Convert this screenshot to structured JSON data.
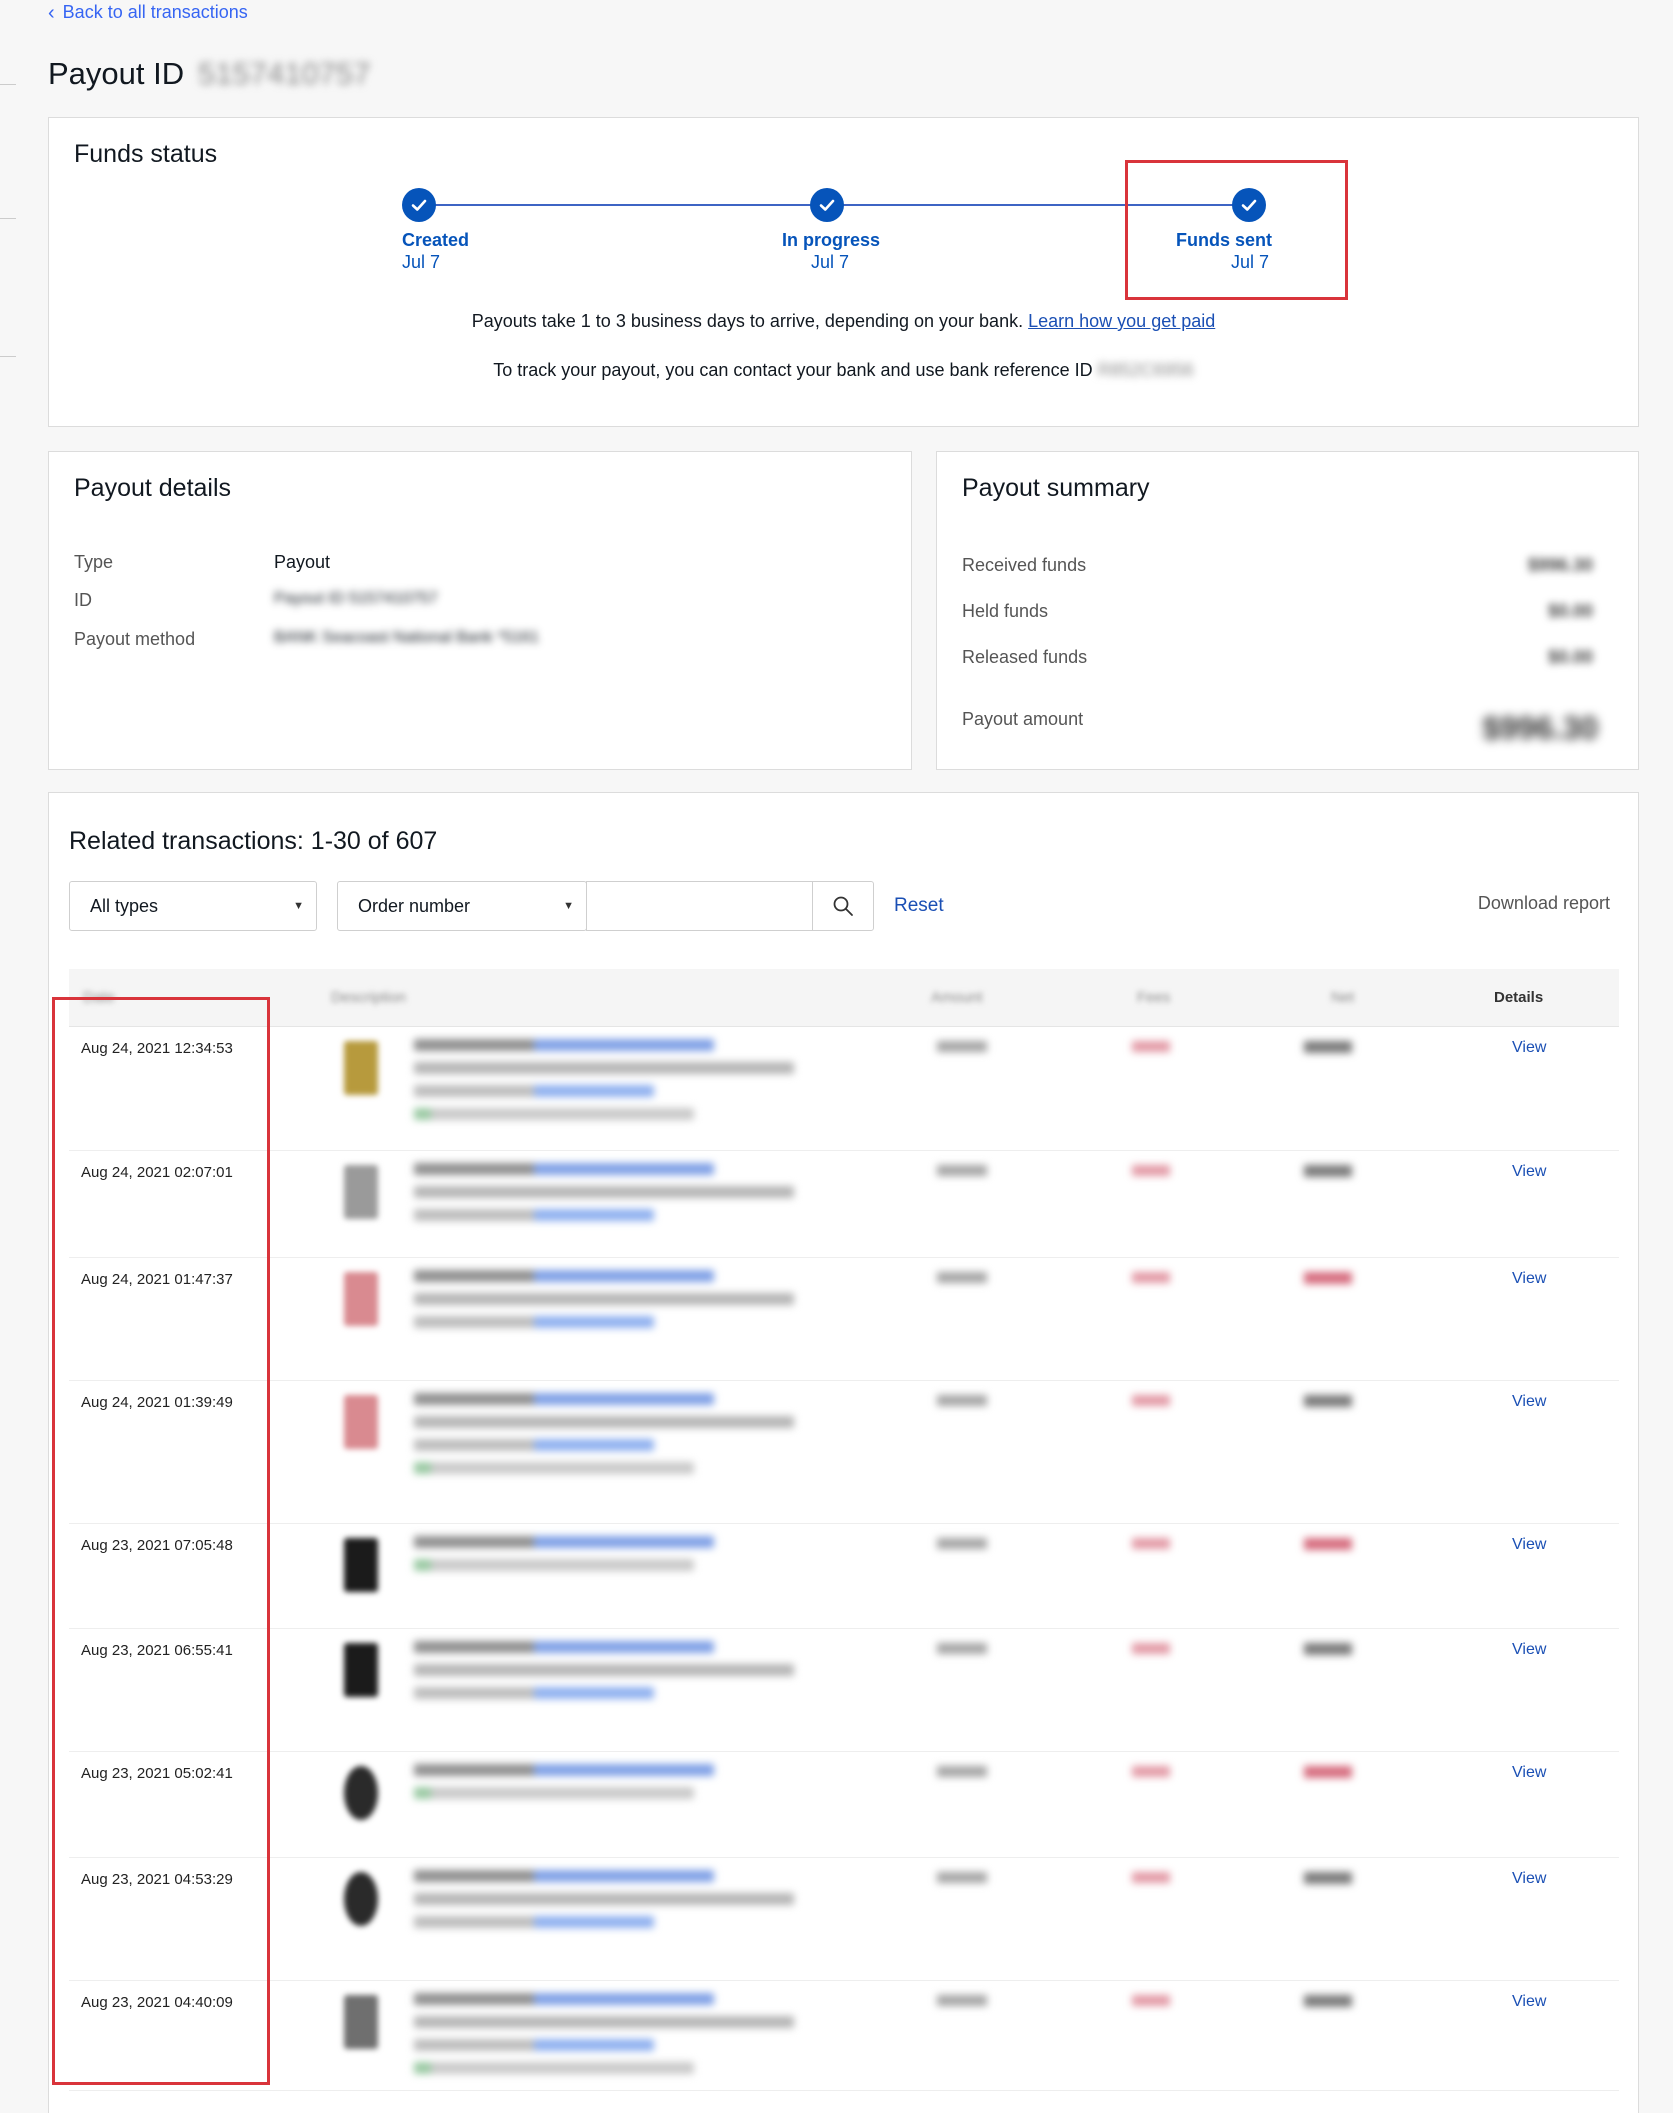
{
  "back_link": {
    "label": "Back to all transactions"
  },
  "page_title": {
    "label": "Payout ID",
    "id_blurred": "5157410757"
  },
  "funds_status": {
    "title": "Funds status",
    "steps": [
      {
        "label": "Created",
        "date": "Jul 7"
      },
      {
        "label": "In progress",
        "date": "Jul 7"
      },
      {
        "label": "Funds sent",
        "date": "Jul 7"
      }
    ],
    "note_line1": "Payouts take 1 to 3 business days to arrive, depending on your bank.",
    "learn_link": "Learn how you get paid",
    "note_line2": "To track your payout, you can contact your bank and use bank reference ID",
    "bank_ref_blurred": "R852C6956"
  },
  "payout_details": {
    "title": "Payout details",
    "type_label": "Type",
    "type_value": "Payout",
    "id_label": "ID",
    "id_value_blurred": "Payout ID 5157410757",
    "method_label": "Payout method",
    "method_value_blurred": "BANK Seacoast National Bank *5161"
  },
  "payout_summary": {
    "title": "Payout summary",
    "received_label": "Received funds",
    "received_value": "$996.30",
    "held_label": "Held funds",
    "held_value": "$0.00",
    "released_label": "Released funds",
    "released_value": "$0.00",
    "payout_label": "Payout amount",
    "payout_value": "$996.30"
  },
  "transactions": {
    "title": "Related transactions: 1-30 of 607",
    "type_filter": "All types",
    "search_by": "Order number",
    "search_placeholder": "",
    "reset": "Reset",
    "download": "Download report",
    "columns": {
      "date": "Date",
      "description": "Description",
      "amount": "Amount",
      "fees": "Fees",
      "net": "Net",
      "details": "Details"
    },
    "rows": [
      {
        "date": "Aug 24, 2021 12:34:53",
        "view": "View"
      },
      {
        "date": "Aug 24, 2021 02:07:01",
        "view": "View"
      },
      {
        "date": "Aug 24, 2021 01:47:37",
        "view": "View"
      },
      {
        "date": "Aug 24, 2021 01:39:49",
        "view": "View"
      },
      {
        "date": "Aug 23, 2021 07:05:48",
        "view": "View"
      },
      {
        "date": "Aug 23, 2021 06:55:41",
        "view": "View"
      },
      {
        "date": "Aug 23, 2021 05:02:41",
        "view": "View"
      },
      {
        "date": "Aug 23, 2021 04:53:29",
        "view": "View"
      },
      {
        "date": "Aug 23, 2021 04:40:09",
        "view": "View"
      }
    ]
  },
  "colors": {
    "accent": "#0654ba",
    "link": "#1a4fb4",
    "highlight": "#d9343b"
  }
}
